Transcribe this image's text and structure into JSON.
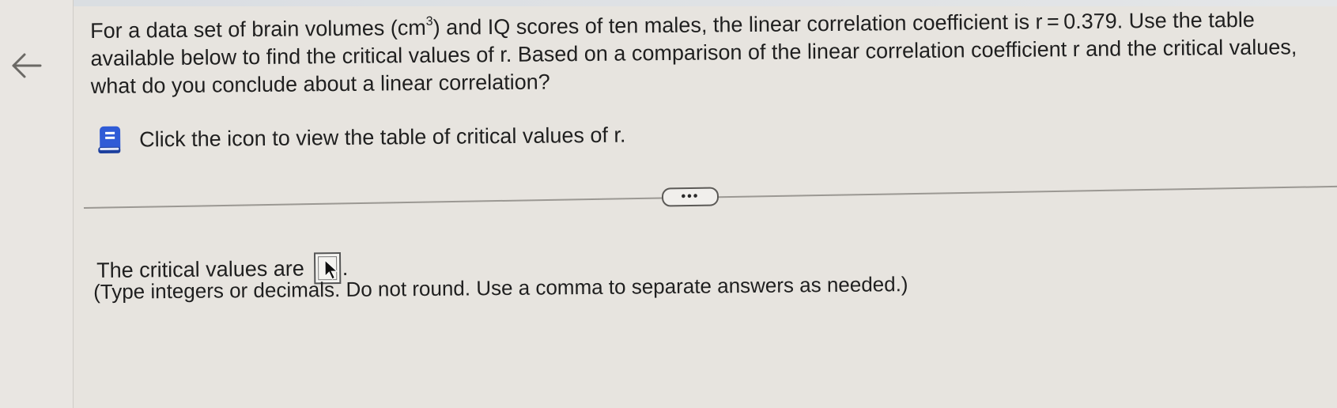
{
  "question": {
    "part1": "For a data set of brain volumes (cm",
    "superscript": "3",
    "part2": ") and IQ scores of ten males, the linear correlation coefficient is r = 0.379. Use the table available below to find the critical values of r. Based on a comparison of the linear correlation coefficient r and the critical values, what do you conclude about a linear correlation?"
  },
  "hint": {
    "icon": "book-icon",
    "text": "Click the icon to view the table of critical values of r."
  },
  "more_button": {
    "label": "•••"
  },
  "answer": {
    "prefix": "The critical values are",
    "value": "",
    "suffix": ".",
    "instructions": "(Type integers or decimals. Do not round. Use a comma to separate answers as needed.)"
  },
  "colors": {
    "background": "#e7e4df",
    "icon_blue": "#2f5bd6",
    "text": "#1f1f1f"
  }
}
